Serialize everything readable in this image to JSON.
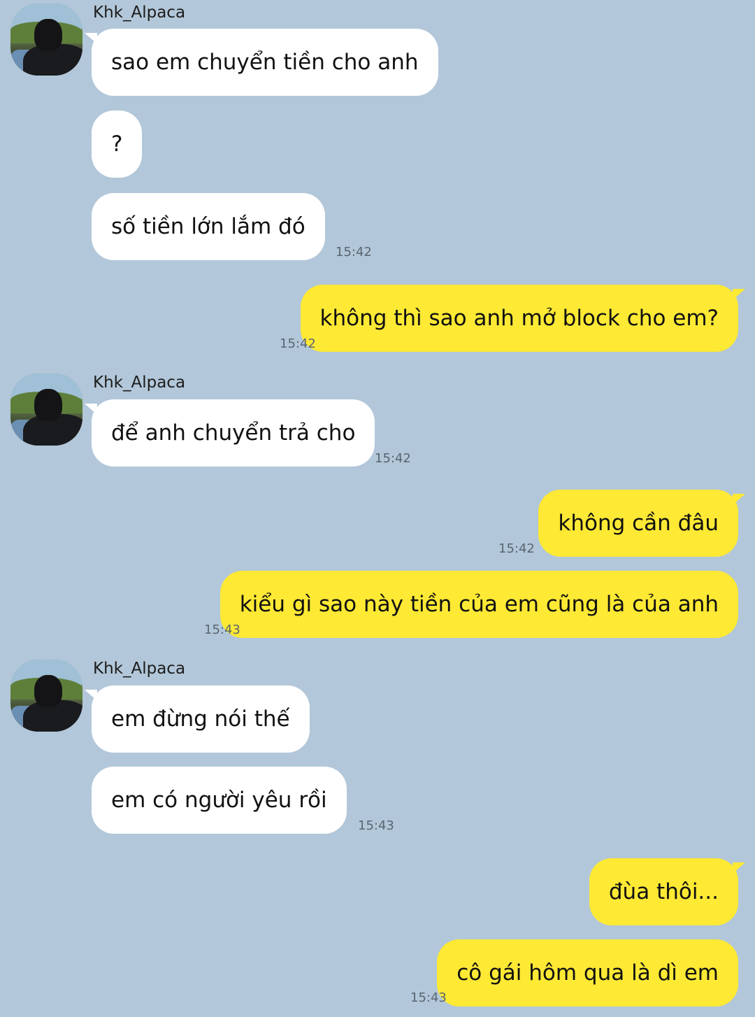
{
  "sender_name": "Khk_Alpaca",
  "messages": [
    {
      "side": "in",
      "text": "sao em chuyển tiền cho anh"
    },
    {
      "side": "in",
      "text": "?"
    },
    {
      "side": "in",
      "text": "số tiền lớn lắm đó",
      "time": "15:42"
    },
    {
      "side": "out",
      "text": "không thì sao anh mở block cho em?",
      "time": "15:42"
    },
    {
      "side": "in",
      "text": "để anh chuyển trả cho",
      "time": "15:42"
    },
    {
      "side": "out",
      "text": "không cần đâu",
      "time": "15:42"
    },
    {
      "side": "out",
      "text": "kiểu gì sao này tiền của em cũng là của anh",
      "time": "15:43"
    },
    {
      "side": "in",
      "text": "em đừng nói thế"
    },
    {
      "side": "in",
      "text": "em có người yêu rồi",
      "time": "15:43"
    },
    {
      "side": "out",
      "text": "đùa thôi..."
    },
    {
      "side": "out",
      "text": "cô gái hôm qua là dì em",
      "time": "15:43"
    }
  ],
  "colors": {
    "background": "#b2c7d9",
    "incoming": "#ffffff",
    "outgoing": "#fee934"
  }
}
